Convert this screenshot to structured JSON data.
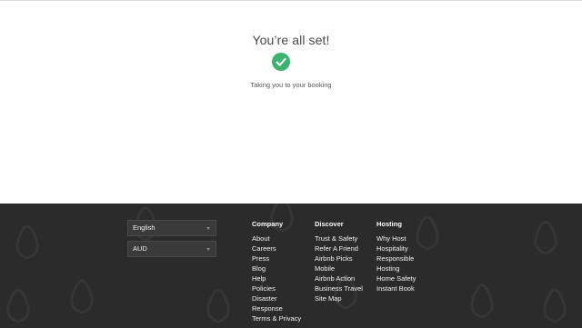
{
  "confirmation": {
    "title": "You’re all set!",
    "subtitle": "Taking you to your booking"
  },
  "icons": {
    "success": "check-circle-icon",
    "select_caret": "chevron-down-icon",
    "success_color": "#3cb371"
  },
  "footer": {
    "background_color": "#2b2b2b",
    "language_select": {
      "value": "English"
    },
    "currency_select": {
      "value": "AUD"
    },
    "columns": [
      {
        "title": "Company",
        "links": [
          "About",
          "Careers",
          "Press",
          "Blog",
          "Help",
          "Policies",
          "Disaster",
          "Response",
          "Terms & Privacy"
        ]
      },
      {
        "title": "Discover",
        "links": [
          "Trust & Safety",
          "Refer A Friend",
          "Airbnb Picks",
          "Mobile",
          "Airbnb Action",
          "Business Travel",
          "Site Map"
        ]
      },
      {
        "title": "Hosting",
        "links": [
          "Why Host",
          "Hospitality",
          "Responsible",
          "Hosting",
          "Home Safety",
          "Instant Book"
        ]
      }
    ]
  }
}
